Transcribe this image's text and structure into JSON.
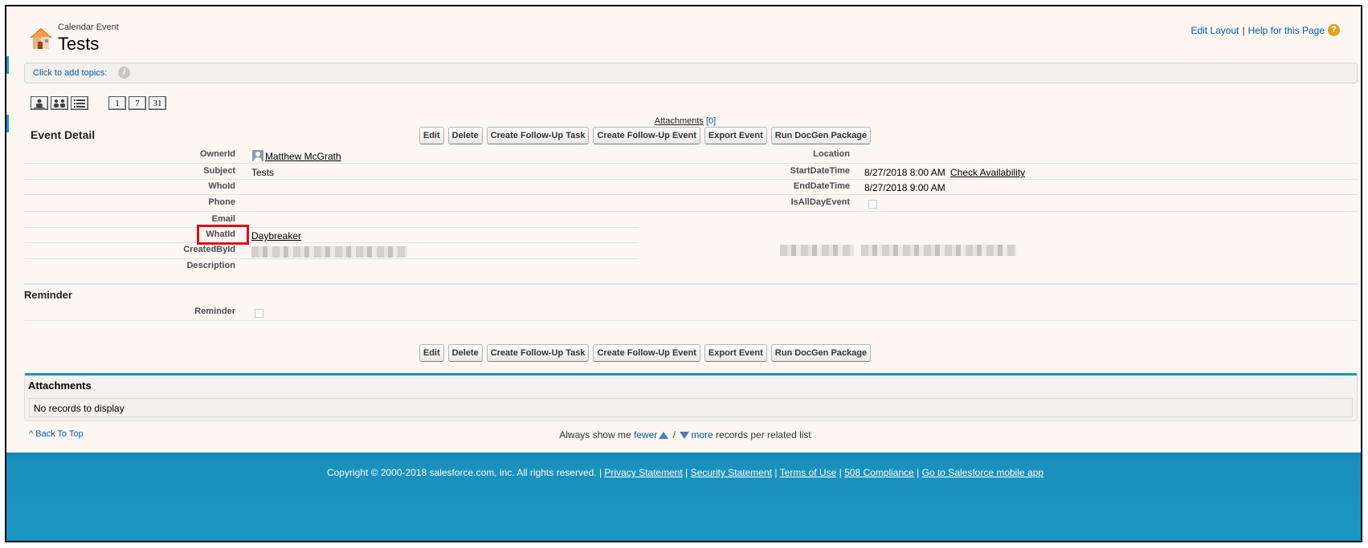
{
  "header": {
    "type_label": "Calendar Event",
    "title": "Tests",
    "edit_layout": "Edit Layout",
    "separator": "|",
    "help_link": "Help for this Page",
    "help_icon": "?"
  },
  "topics": {
    "link": "Click to add topics:",
    "info_icon": "i"
  },
  "view_buttons": {
    "day_view": "1",
    "week_view": "7",
    "month_view": "31"
  },
  "attachments_link": {
    "label": "Attachments",
    "count": "[0]"
  },
  "event_detail": {
    "title": "Event Detail",
    "buttons": [
      "Edit",
      "Delete",
      "Create Follow-Up Task",
      "Create Follow-Up Event",
      "Export Event",
      "Run DocGen Package"
    ],
    "left_fields": {
      "owner_label": "OwnerId",
      "owner_value": "Matthew McGrath",
      "subject_label": "Subject",
      "subject_value": "Tests",
      "whoid_label": "WhoId",
      "phone_label": "Phone",
      "email_label": "Email",
      "whatid_label": "WhatId",
      "whatid_value": "Daybreaker",
      "createdby_label": "CreatedById",
      "description_label": "Description"
    },
    "right_fields": {
      "location_label": "Location",
      "start_label": "StartDateTime",
      "start_value": "8/27/2018 8:00 AM",
      "check_availability": "Check Availability",
      "end_label": "EndDateTime",
      "end_value": "8/27/2018 9:00 AM",
      "allday_label": "IsAllDayEvent"
    }
  },
  "reminder": {
    "title": "Reminder",
    "label": "Reminder"
  },
  "bottom_buttons": [
    "Edit",
    "Delete",
    "Create Follow-Up Task",
    "Create Follow-Up Event",
    "Export Event",
    "Run DocGen Package"
  ],
  "attachments_list": {
    "title": "Attachments",
    "empty": "No records to display"
  },
  "back_to_top": "Back To Top",
  "show_me": {
    "prefix": "Always show me",
    "fewer": "fewer",
    "slash": "/",
    "more": "more",
    "suffix": "records per related list"
  },
  "footer": {
    "copyright": "Copyright © 2000-2018 salesforce.com, inc. All rights reserved. |",
    "privacy": "Privacy Statement",
    "security": "Security Statement",
    "terms": "Terms of Use",
    "compliance": "508 Compliance",
    "mobile": "Go to Salesforce mobile app",
    "sep": "|"
  },
  "colors": {
    "accent": "#1797c0",
    "link": "#015ba7",
    "highlight": "#d9101e",
    "page_bg": "#fdf6f2"
  }
}
